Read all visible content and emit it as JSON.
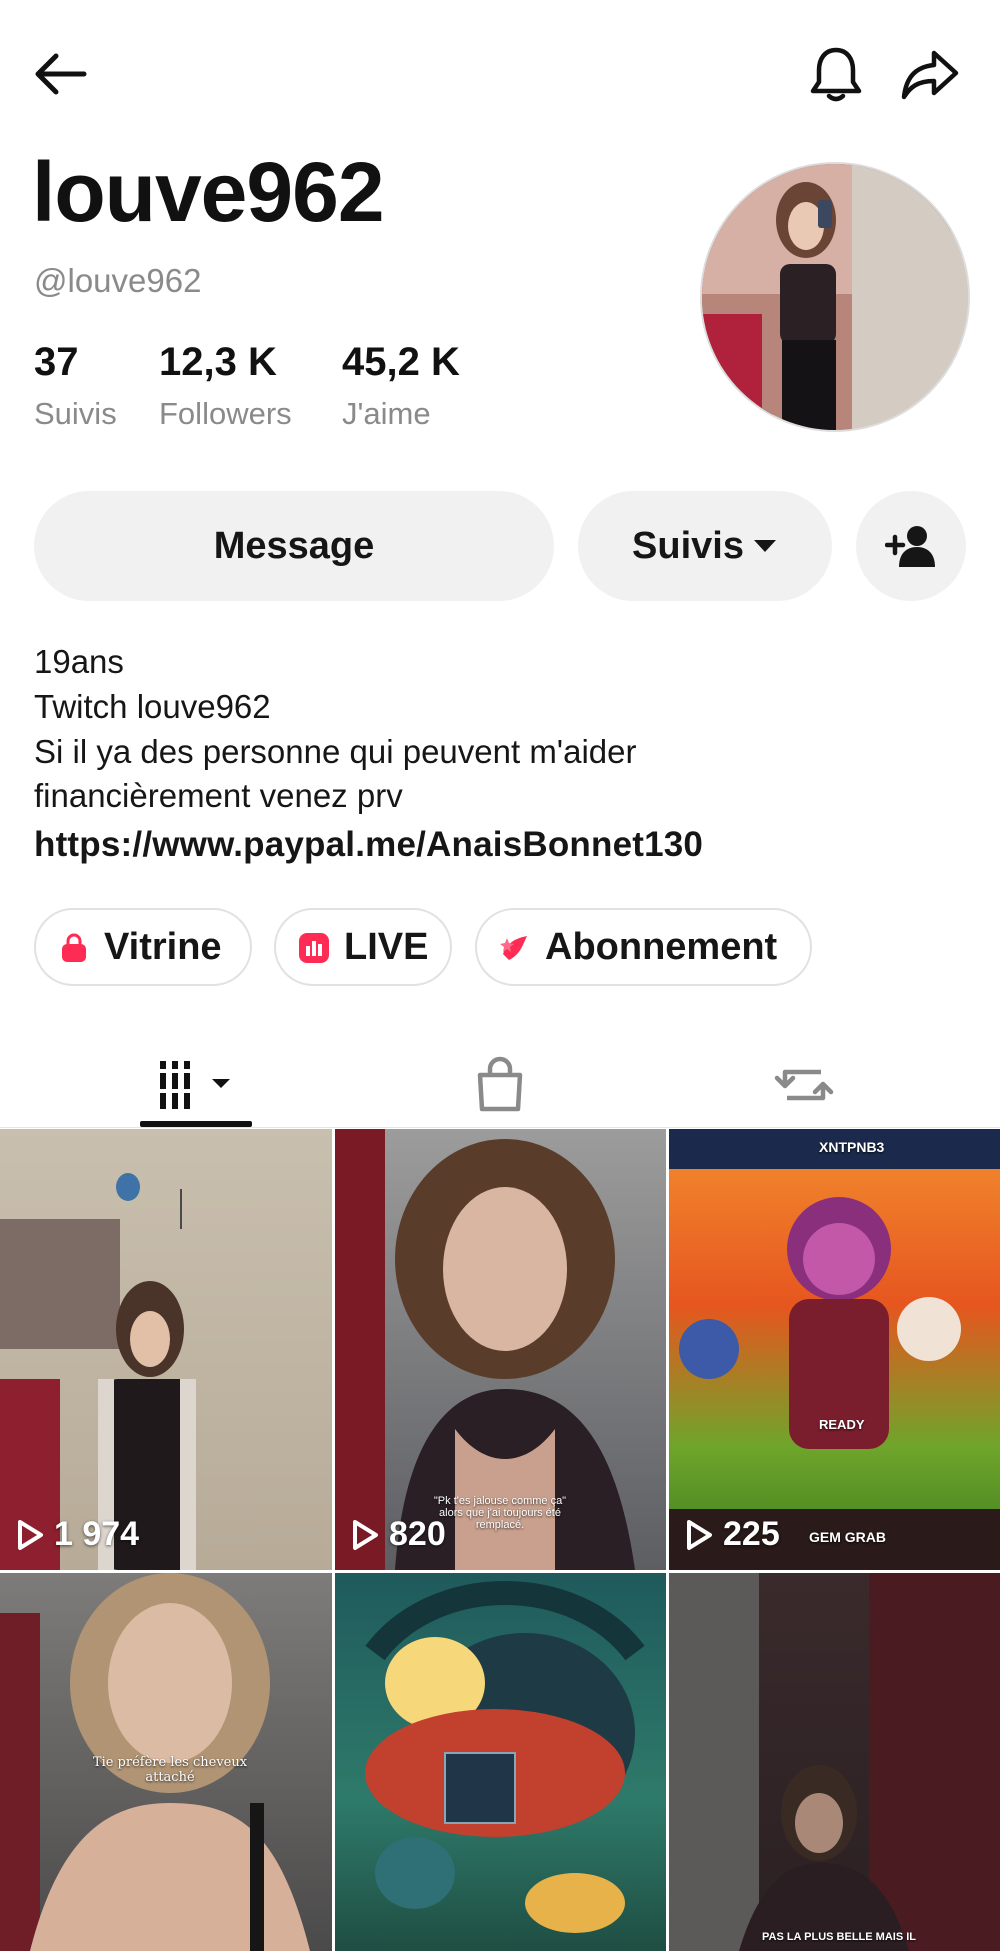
{
  "header": {
    "back_icon": "arrow-left-icon",
    "bell_icon": "bell-icon",
    "share_icon": "share-arrow-icon"
  },
  "profile": {
    "display_name": "louve962",
    "handle": "@louve962",
    "stats": [
      {
        "value": "37",
        "label": "Suivis"
      },
      {
        "value": "12,3 K",
        "label": "Followers"
      },
      {
        "value": "45,2 K",
        "label": "J'aime"
      }
    ]
  },
  "actions": {
    "message_label": "Message",
    "following_label": "Suivis",
    "add_user_icon": "add-user-icon"
  },
  "bio": {
    "lines": [
      "19ans",
      "Twitch louve962",
      "Si il ya des personne qui peuvent m'aider",
      "financièrement venez prv"
    ],
    "link": "https://www.paypal.me/AnaisBonnet130"
  },
  "chips": [
    {
      "label": "Vitrine",
      "icon": "shopping-bag-icon",
      "color": "#fe2c55"
    },
    {
      "label": "LIVE",
      "icon": "live-icon",
      "color": "#fe2c55"
    },
    {
      "label": "Abonnement",
      "icon": "subscription-star-icon",
      "color": "#fe2c55"
    }
  ],
  "tabs": [
    {
      "name": "videos",
      "icon": "grid-videos-icon",
      "active": true
    },
    {
      "name": "shop",
      "icon": "shopping-bag-icon",
      "active": false
    },
    {
      "name": "reposts",
      "icon": "repost-icon",
      "active": false
    }
  ],
  "videos": [
    {
      "views": "1 974"
    },
    {
      "views": "820",
      "caption": "\"Pk t'es jalouse comme ça\" alors que j'ai toujours été remplacé."
    },
    {
      "views": "225",
      "game_code": "XNTPNB3",
      "game_text": "GEM GRAB",
      "ready_label": "READY"
    },
    {
      "caption": "Tie préfère les cheveux attaché"
    },
    {},
    {
      "caption": "PAS LA PLUS BELLE MAIS IL"
    }
  ],
  "colors": {
    "accent": "#fe2c55",
    "text": "#161616",
    "muted": "#8a8a8a",
    "button_bg": "#f1f1f2"
  }
}
